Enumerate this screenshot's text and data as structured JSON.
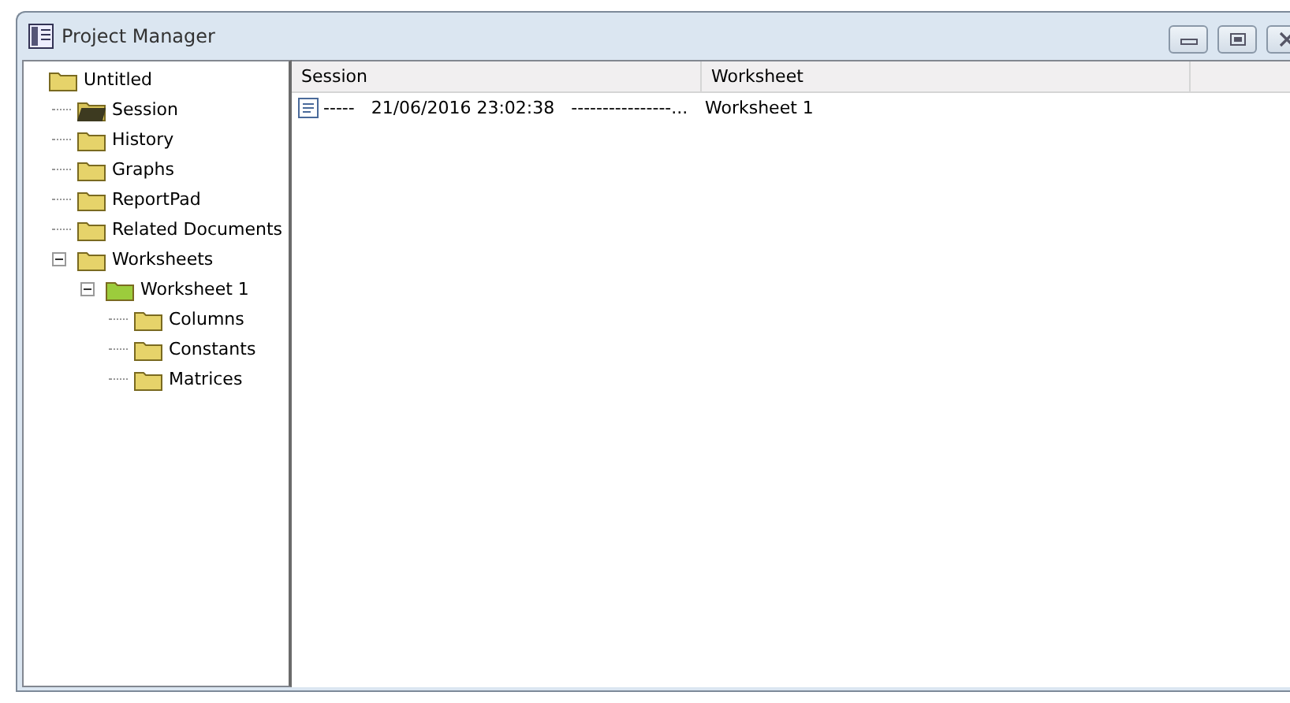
{
  "window": {
    "title": "Project Manager",
    "buttons": [
      {
        "kind": "minimize"
      },
      {
        "kind": "restore"
      },
      {
        "kind": "close"
      }
    ]
  },
  "tree": {
    "label": "Untitled",
    "kind": "folder",
    "children": [
      {
        "label": "Session",
        "kind": "open-folder"
      },
      {
        "label": "History",
        "kind": "folder"
      },
      {
        "label": "Graphs",
        "kind": "folder"
      },
      {
        "label": "ReportPad",
        "kind": "folder"
      },
      {
        "label": "Related Documents",
        "kind": "folder"
      },
      {
        "label": "Worksheets",
        "kind": "folder",
        "expanded": true,
        "children": [
          {
            "label": "Worksheet 1",
            "kind": "worksheet",
            "expanded": true,
            "children": [
              {
                "label": "Columns",
                "kind": "folder"
              },
              {
                "label": "Constants",
                "kind": "folder"
              },
              {
                "label": "Matrices",
                "kind": "folder"
              }
            ]
          }
        ]
      }
    ]
  },
  "table": {
    "columns": [
      "Session",
      "Worksheet"
    ],
    "rows": [
      {
        "session": "-----   21/06/2016 23:02:38   ----------------...",
        "worksheet": "Worksheet 1"
      }
    ]
  }
}
